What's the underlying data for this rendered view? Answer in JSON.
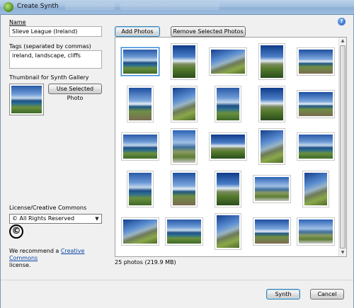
{
  "window": {
    "title": "Create Synth"
  },
  "form": {
    "name_label": "Name",
    "name_value": "Slieve League (Ireland)",
    "tags_label": "Tags (separated by commas)",
    "tags_value": "ireland, landscape, cliffs",
    "thumbnail_label": "Thumbnail for Synth Gallery",
    "use_selected_label": "Use Selected Photo",
    "license_label": "License/Creative Commons",
    "license_value": "© All Rights Reserved",
    "cc_symbol": "©",
    "recommend_prefix": "We recommend a",
    "recommend_link": "Creative Commons",
    "recommend_suffix": "license."
  },
  "toolbar": {
    "add_photos_label": "Add Photos",
    "remove_label": "Remove Selected Photos"
  },
  "gallery": {
    "status": "25 photos (219.9 MB)",
    "photos": [
      {
        "orientation": "land",
        "tone": "p1",
        "selected": true
      },
      {
        "orientation": "port",
        "tone": "p2"
      },
      {
        "orientation": "land",
        "tone": "p3"
      },
      {
        "orientation": "port",
        "tone": "p2"
      },
      {
        "orientation": "land",
        "tone": "p4"
      },
      {
        "orientation": "port",
        "tone": "p4"
      },
      {
        "orientation": "port",
        "tone": "p3"
      },
      {
        "orientation": "port",
        "tone": "p1"
      },
      {
        "orientation": "port",
        "tone": "p2"
      },
      {
        "orientation": "land",
        "tone": "p4"
      },
      {
        "orientation": "land",
        "tone": "p1"
      },
      {
        "orientation": "port",
        "tone": "p5"
      },
      {
        "orientation": "land",
        "tone": "p2"
      },
      {
        "orientation": "port",
        "tone": "p3"
      },
      {
        "orientation": "land",
        "tone": "p1"
      },
      {
        "orientation": "port",
        "tone": "p1"
      },
      {
        "orientation": "port",
        "tone": "p4"
      },
      {
        "orientation": "port",
        "tone": "p2"
      },
      {
        "orientation": "land",
        "tone": "p5"
      },
      {
        "orientation": "port",
        "tone": "p3"
      },
      {
        "orientation": "land",
        "tone": "p3"
      },
      {
        "orientation": "land",
        "tone": "p1"
      },
      {
        "orientation": "port",
        "tone": "p3"
      },
      {
        "orientation": "land",
        "tone": "p4"
      },
      {
        "orientation": "land",
        "tone": "p5"
      }
    ]
  },
  "footer": {
    "synth_label": "Synth",
    "cancel_label": "Cancel"
  },
  "icons": {
    "help": "help-icon",
    "app": "synth-app-icon",
    "dropdown": "chevron-down-icon",
    "cc": "copyright-icon"
  }
}
